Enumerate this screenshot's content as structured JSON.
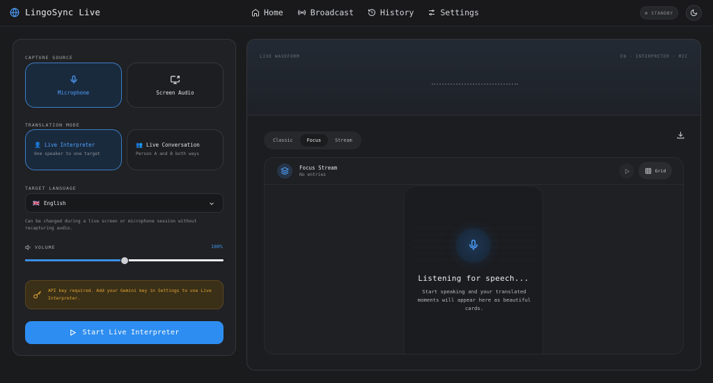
{
  "header": {
    "app_name": "LingoSync Live",
    "nav": [
      {
        "label": "Home",
        "icon": "home-icon"
      },
      {
        "label": "Broadcast",
        "icon": "broadcast-icon"
      },
      {
        "label": "History",
        "icon": "history-icon"
      },
      {
        "label": "Settings",
        "icon": "settings-icon"
      }
    ],
    "status": "STANDBY"
  },
  "left": {
    "capture_label": "CAPTURE SOURCE",
    "sources": [
      {
        "label": "Microphone",
        "icon": "microphone-icon",
        "selected": true
      },
      {
        "label": "Screen Audio",
        "icon": "screen-share-icon",
        "selected": false
      }
    ],
    "mode_label": "TRANSLATION MODE",
    "modes": [
      {
        "emoji": "👤",
        "title": "Live Interpreter",
        "subtitle": "One speaker to one target",
        "selected": true
      },
      {
        "emoji": "👥",
        "title": "Live Conversation",
        "subtitle": "Person A and B both ways",
        "selected": false
      }
    ],
    "language_label": "TARGET LANGUAGE",
    "language": {
      "flag": "🇬🇧",
      "value": "English"
    },
    "language_hint": "Can be changed during a live screen or microphone session without recapturing audio.",
    "volume_label": "VOLUME",
    "volume_display": "100%",
    "volume_slider_level": 0.5,
    "alert": "API key required. Add your Gemini key in Settings to use Live Interpreter.",
    "start_label": "Start Live Interpreter"
  },
  "right": {
    "wave_label": "LIVE WAVEFORM",
    "wave_meta": "EN · INTERPRETER · MIC",
    "view_tabs": [
      {
        "label": "Classic",
        "active": false
      },
      {
        "label": "Focus",
        "active": true
      },
      {
        "label": "Stream",
        "active": false
      }
    ],
    "stream_title": "Focus Stream",
    "stream_sub": "No entries",
    "grid_label": "Grid",
    "empty_title": "Listening for speech...",
    "empty_desc": "Start speaking and your translated moments will appear here as beautiful cards."
  },
  "colors": {
    "accent": "#2e8df0",
    "warning": "#e3a634",
    "background": "#1a1b1d"
  }
}
